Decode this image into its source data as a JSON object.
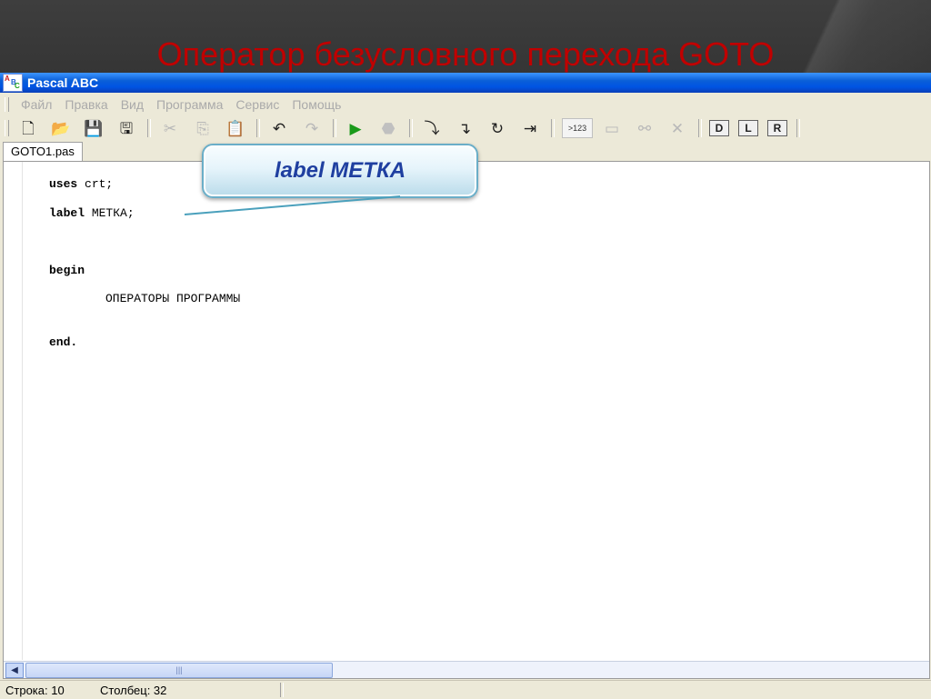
{
  "slide": {
    "title": "Оператор безусловного перехода GOTO"
  },
  "window": {
    "title": "Pascal ABC",
    "icon_letters": [
      "A",
      "B",
      "C"
    ]
  },
  "menu": {
    "items": [
      "Файл",
      "Правка",
      "Вид",
      "Программа",
      "Сервис",
      "Помощь"
    ]
  },
  "toolbar": {
    "buttons": [
      {
        "name": "new-file-icon",
        "glyph": "🗋",
        "enabled": true
      },
      {
        "name": "open-folder-icon",
        "glyph": "📂",
        "enabled": true
      },
      {
        "name": "save-icon",
        "glyph": "💾",
        "enabled": true
      },
      {
        "name": "save-all-icon",
        "glyph": "🖫",
        "enabled": true
      },
      {
        "name": "cut-icon",
        "glyph": "✂",
        "enabled": false
      },
      {
        "name": "copy-icon",
        "glyph": "⎘",
        "enabled": false
      },
      {
        "name": "paste-icon",
        "glyph": "📋",
        "enabled": false
      },
      {
        "name": "undo-icon",
        "glyph": "↶",
        "enabled": true
      },
      {
        "name": "redo-icon",
        "glyph": "↷",
        "enabled": false
      },
      {
        "name": "run-icon",
        "glyph": "▶",
        "enabled": true
      },
      {
        "name": "stop-icon",
        "glyph": "⬣",
        "enabled": false
      },
      {
        "name": "step-into-icon",
        "glyph": "⤵",
        "enabled": true
      },
      {
        "name": "step-over-icon",
        "glyph": "↴",
        "enabled": true
      },
      {
        "name": "step-out-icon",
        "glyph": "↻",
        "enabled": true
      },
      {
        "name": "run-to-cursor-icon",
        "glyph": "⇥",
        "enabled": true
      }
    ],
    "number_field": ">123",
    "extra_buttons": [
      {
        "name": "window-icon",
        "glyph": "▭",
        "enabled": false
      },
      {
        "name": "watch-icon",
        "glyph": "⚯",
        "enabled": false
      },
      {
        "name": "delete-icon",
        "glyph": "✕",
        "enabled": false
      },
      {
        "name": "debug-d-icon",
        "glyph": "D",
        "enabled": true
      },
      {
        "name": "debug-l-icon",
        "glyph": "L",
        "enabled": true
      },
      {
        "name": "debug-r-icon",
        "glyph": "R",
        "enabled": true
      }
    ]
  },
  "editor": {
    "tab_label": "GOTO1.pas",
    "lines": [
      {
        "keyword": "uses",
        "rest": " crt;"
      },
      {
        "keyword": "label",
        "rest": " МЕТКА;"
      },
      {
        "keyword": "begin",
        "rest": ""
      },
      {
        "keyword": "",
        "rest": "ОПЕРАТОРЫ ПРОГРАММЫ"
      },
      {
        "keyword": "end.",
        "rest": ""
      }
    ]
  },
  "callout": {
    "text": "label МЕТКА"
  },
  "status": {
    "row": "Строка: 10",
    "col": "Столбец: 32"
  },
  "colors": {
    "slide_title": "#c00000",
    "titlebar": "#0054e3",
    "callout_text": "#1f3fa0"
  }
}
